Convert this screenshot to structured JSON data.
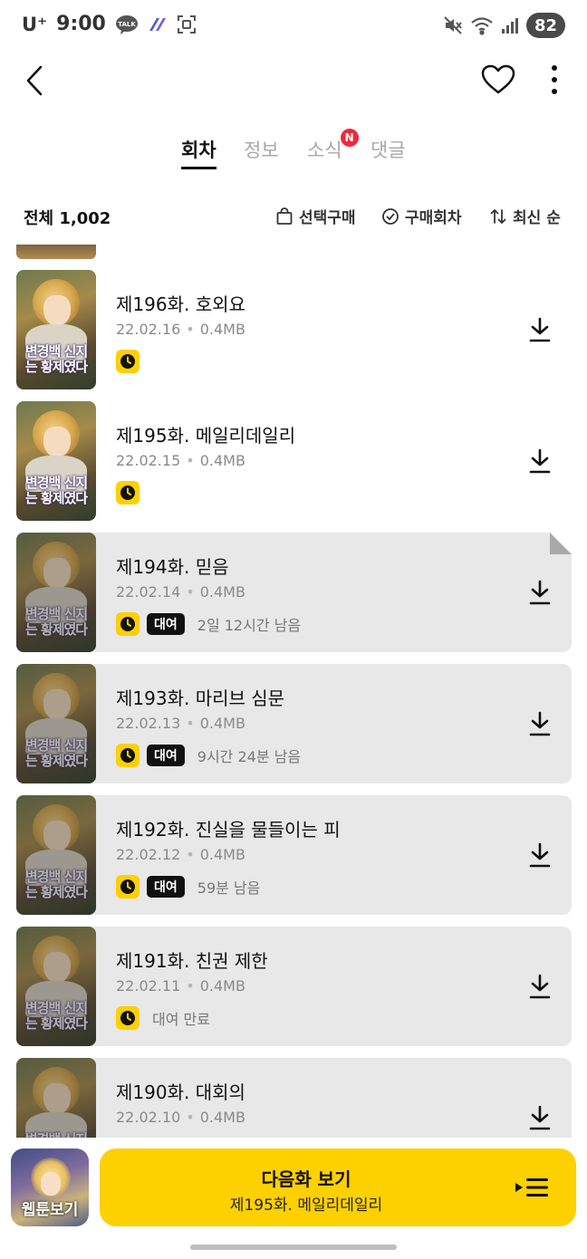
{
  "status_bar": {
    "carrier": "U⁺",
    "time": "9:00",
    "battery": "82",
    "icons": [
      "kakaotalk-icon",
      "app-icon",
      "screenshot-icon",
      "mute-icon",
      "wifi-icon",
      "signal-icon"
    ]
  },
  "header": {
    "back_icon": "chevron-left-icon",
    "like_icon": "heart-outline-icon",
    "more_icon": "more-vertical-icon"
  },
  "tabs": [
    {
      "label": "회차",
      "active": true
    },
    {
      "label": "정보",
      "active": false
    },
    {
      "label": "소식",
      "active": false,
      "badge": "N"
    },
    {
      "label": "댓글",
      "active": false
    }
  ],
  "toolbar": {
    "total_label": "전체 1,002",
    "select_buy": "선택구매",
    "purchased": "구매회차",
    "sort": "최신 순"
  },
  "thumbnail_title": "변경백 신지는 황제였다",
  "episodes": [
    {
      "title": "제196화. 호외요",
      "date": "22.02.16",
      "size": "0.4MB",
      "read": false,
      "rent": false,
      "rent_text": ""
    },
    {
      "title": "제195화. 메일리데일리",
      "date": "22.02.15",
      "size": "0.4MB",
      "read": false,
      "rent": false,
      "rent_text": ""
    },
    {
      "title": "제194화. 믿음",
      "date": "22.02.14",
      "size": "0.4MB",
      "read": true,
      "rent": true,
      "rent_label": "대여",
      "rent_text": "2일 12시간 남음"
    },
    {
      "title": "제193화. 마리브 심문",
      "date": "22.02.13",
      "size": "0.4MB",
      "read": true,
      "rent": true,
      "rent_label": "대여",
      "rent_text": "9시간 24분 남음"
    },
    {
      "title": "제192화. 진실을 물들이는 피",
      "date": "22.02.12",
      "size": "0.4MB",
      "read": true,
      "rent": true,
      "rent_label": "대여",
      "rent_text": "59분 남음"
    },
    {
      "title": "제191화. 친권 제한",
      "date": "22.02.11",
      "size": "0.4MB",
      "read": true,
      "rent": false,
      "rent_text": "대여 만료"
    },
    {
      "title": "제190화. 대회의",
      "date": "22.02.10",
      "size": "0.4MB",
      "read": true,
      "rent": false,
      "rent_text": ""
    }
  ],
  "bottom": {
    "webtoon_label": "웹툰보기",
    "next_title": "다음화 보기",
    "next_sub": "제195화. 메일리데일리"
  },
  "colors": {
    "accent_yellow": "#fdd000",
    "read_bg": "#e8e8e8",
    "badge_red": "#ec2b3c"
  }
}
